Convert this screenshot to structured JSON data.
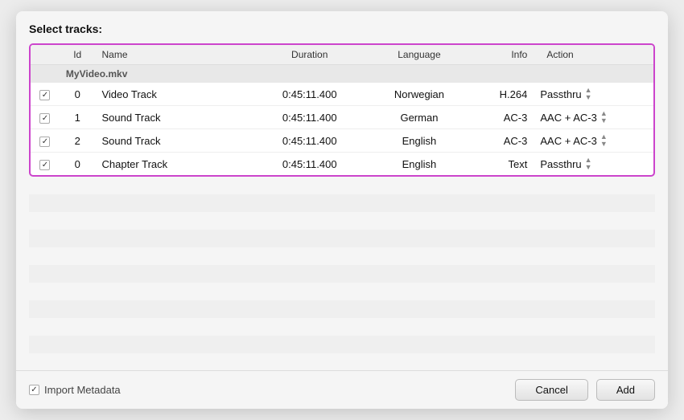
{
  "dialog": {
    "title": "Select tracks:",
    "columns": {
      "check": "",
      "id": "Id",
      "name": "Name",
      "duration": "Duration",
      "language": "Language",
      "info": "Info",
      "action": "Action"
    },
    "file": "MyVideo.mkv",
    "tracks": [
      {
        "checked": true,
        "id": "0",
        "name": "Video Track",
        "duration": "0:45:11.400",
        "language": "Norwegian",
        "info": "H.264",
        "action": "Passthru"
      },
      {
        "checked": true,
        "id": "1",
        "name": "Sound Track",
        "duration": "0:45:11.400",
        "language": "German",
        "info": "AC-3",
        "action": "AAC + AC-3"
      },
      {
        "checked": true,
        "id": "2",
        "name": "Sound Track",
        "duration": "0:45:11.400",
        "language": "English",
        "info": "AC-3",
        "action": "AAC + AC-3"
      },
      {
        "checked": true,
        "id": "0",
        "name": "Chapter Track",
        "duration": "0:45:11.400",
        "language": "English",
        "info": "Text",
        "action": "Passthru"
      }
    ],
    "footer": {
      "import_meta_label": "Import Metadata",
      "cancel_label": "Cancel",
      "add_label": "Add"
    }
  }
}
